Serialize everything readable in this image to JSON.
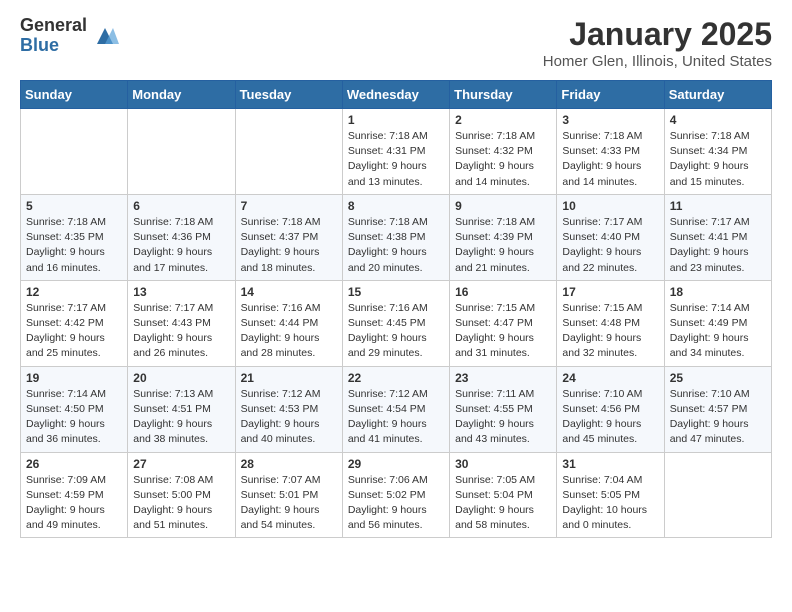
{
  "header": {
    "logo_general": "General",
    "logo_blue": "Blue",
    "month_title": "January 2025",
    "location": "Homer Glen, Illinois, United States"
  },
  "days_of_week": [
    "Sunday",
    "Monday",
    "Tuesday",
    "Wednesday",
    "Thursday",
    "Friday",
    "Saturday"
  ],
  "weeks": [
    [
      {
        "day": "",
        "info": ""
      },
      {
        "day": "",
        "info": ""
      },
      {
        "day": "",
        "info": ""
      },
      {
        "day": "1",
        "info": "Sunrise: 7:18 AM\nSunset: 4:31 PM\nDaylight: 9 hours\nand 13 minutes."
      },
      {
        "day": "2",
        "info": "Sunrise: 7:18 AM\nSunset: 4:32 PM\nDaylight: 9 hours\nand 14 minutes."
      },
      {
        "day": "3",
        "info": "Sunrise: 7:18 AM\nSunset: 4:33 PM\nDaylight: 9 hours\nand 14 minutes."
      },
      {
        "day": "4",
        "info": "Sunrise: 7:18 AM\nSunset: 4:34 PM\nDaylight: 9 hours\nand 15 minutes."
      }
    ],
    [
      {
        "day": "5",
        "info": "Sunrise: 7:18 AM\nSunset: 4:35 PM\nDaylight: 9 hours\nand 16 minutes."
      },
      {
        "day": "6",
        "info": "Sunrise: 7:18 AM\nSunset: 4:36 PM\nDaylight: 9 hours\nand 17 minutes."
      },
      {
        "day": "7",
        "info": "Sunrise: 7:18 AM\nSunset: 4:37 PM\nDaylight: 9 hours\nand 18 minutes."
      },
      {
        "day": "8",
        "info": "Sunrise: 7:18 AM\nSunset: 4:38 PM\nDaylight: 9 hours\nand 20 minutes."
      },
      {
        "day": "9",
        "info": "Sunrise: 7:18 AM\nSunset: 4:39 PM\nDaylight: 9 hours\nand 21 minutes."
      },
      {
        "day": "10",
        "info": "Sunrise: 7:17 AM\nSunset: 4:40 PM\nDaylight: 9 hours\nand 22 minutes."
      },
      {
        "day": "11",
        "info": "Sunrise: 7:17 AM\nSunset: 4:41 PM\nDaylight: 9 hours\nand 23 minutes."
      }
    ],
    [
      {
        "day": "12",
        "info": "Sunrise: 7:17 AM\nSunset: 4:42 PM\nDaylight: 9 hours\nand 25 minutes."
      },
      {
        "day": "13",
        "info": "Sunrise: 7:17 AM\nSunset: 4:43 PM\nDaylight: 9 hours\nand 26 minutes."
      },
      {
        "day": "14",
        "info": "Sunrise: 7:16 AM\nSunset: 4:44 PM\nDaylight: 9 hours\nand 28 minutes."
      },
      {
        "day": "15",
        "info": "Sunrise: 7:16 AM\nSunset: 4:45 PM\nDaylight: 9 hours\nand 29 minutes."
      },
      {
        "day": "16",
        "info": "Sunrise: 7:15 AM\nSunset: 4:47 PM\nDaylight: 9 hours\nand 31 minutes."
      },
      {
        "day": "17",
        "info": "Sunrise: 7:15 AM\nSunset: 4:48 PM\nDaylight: 9 hours\nand 32 minutes."
      },
      {
        "day": "18",
        "info": "Sunrise: 7:14 AM\nSunset: 4:49 PM\nDaylight: 9 hours\nand 34 minutes."
      }
    ],
    [
      {
        "day": "19",
        "info": "Sunrise: 7:14 AM\nSunset: 4:50 PM\nDaylight: 9 hours\nand 36 minutes."
      },
      {
        "day": "20",
        "info": "Sunrise: 7:13 AM\nSunset: 4:51 PM\nDaylight: 9 hours\nand 38 minutes."
      },
      {
        "day": "21",
        "info": "Sunrise: 7:12 AM\nSunset: 4:53 PM\nDaylight: 9 hours\nand 40 minutes."
      },
      {
        "day": "22",
        "info": "Sunrise: 7:12 AM\nSunset: 4:54 PM\nDaylight: 9 hours\nand 41 minutes."
      },
      {
        "day": "23",
        "info": "Sunrise: 7:11 AM\nSunset: 4:55 PM\nDaylight: 9 hours\nand 43 minutes."
      },
      {
        "day": "24",
        "info": "Sunrise: 7:10 AM\nSunset: 4:56 PM\nDaylight: 9 hours\nand 45 minutes."
      },
      {
        "day": "25",
        "info": "Sunrise: 7:10 AM\nSunset: 4:57 PM\nDaylight: 9 hours\nand 47 minutes."
      }
    ],
    [
      {
        "day": "26",
        "info": "Sunrise: 7:09 AM\nSunset: 4:59 PM\nDaylight: 9 hours\nand 49 minutes."
      },
      {
        "day": "27",
        "info": "Sunrise: 7:08 AM\nSunset: 5:00 PM\nDaylight: 9 hours\nand 51 minutes."
      },
      {
        "day": "28",
        "info": "Sunrise: 7:07 AM\nSunset: 5:01 PM\nDaylight: 9 hours\nand 54 minutes."
      },
      {
        "day": "29",
        "info": "Sunrise: 7:06 AM\nSunset: 5:02 PM\nDaylight: 9 hours\nand 56 minutes."
      },
      {
        "day": "30",
        "info": "Sunrise: 7:05 AM\nSunset: 5:04 PM\nDaylight: 9 hours\nand 58 minutes."
      },
      {
        "day": "31",
        "info": "Sunrise: 7:04 AM\nSunset: 5:05 PM\nDaylight: 10 hours\nand 0 minutes."
      },
      {
        "day": "",
        "info": ""
      }
    ]
  ]
}
